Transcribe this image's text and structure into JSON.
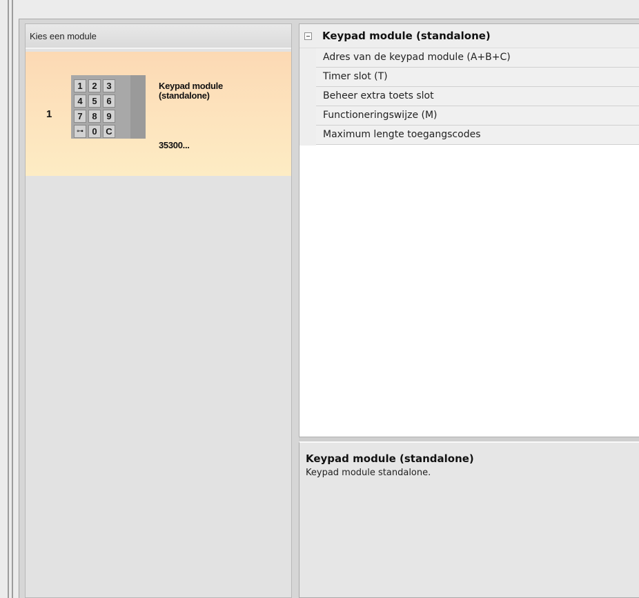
{
  "module_panel": {
    "header": "Kies een module",
    "items": [
      {
        "index": "1",
        "name": "Keypad module (standalone)",
        "code": "35300...",
        "keypad_keys": [
          "1",
          "2",
          "3",
          "4",
          "5",
          "6",
          "7",
          "8",
          "9",
          "⊶",
          "0",
          "C"
        ]
      }
    ]
  },
  "properties": {
    "section_title": "Keypad module (standalone)",
    "rows": [
      "Adres van de keypad module (A+B+C)",
      "Timer slot (T)",
      "Beheer extra toets slot",
      "Functioneringswijze (M)",
      "Maximum lengte toegangscodes"
    ]
  },
  "help": {
    "title": "Keypad module (standalone)",
    "description": "Keypad module standalone."
  },
  "colors": {
    "selected_item_top": "#fcd9b4",
    "selected_item_bottom": "#fdecc4",
    "panel_bg": "#e2e2e2"
  }
}
